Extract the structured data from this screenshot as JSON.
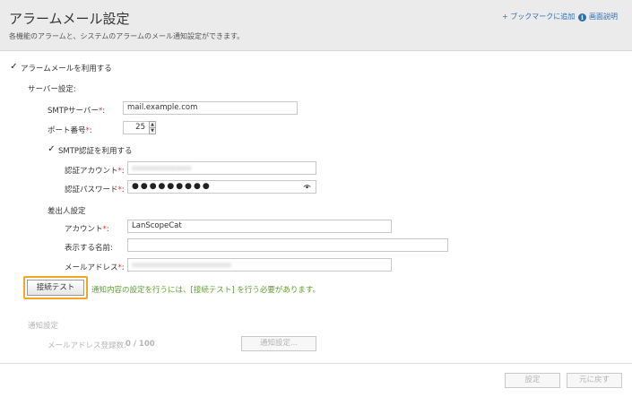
{
  "header": {
    "title": "アラームメール設定",
    "subtitle": "各機能のアラームと、システムのアラームのメール通知設定ができます。",
    "bookmark_link": "+ ブックマークに追加",
    "help_link": "画面説明"
  },
  "use_alarm_mail": {
    "label": "アラームメールを利用する",
    "checked": true
  },
  "server": {
    "section_label": "サーバー設定:",
    "smtp_label": "SMTPサーバー",
    "smtp_value": "mail.example.com",
    "port_label": "ポート番号",
    "port_value": "25",
    "smtp_auth": {
      "label": "SMTP認証を利用する",
      "checked": true
    },
    "account_label": "認証アカウント",
    "account_value": "xxxxxxxxxxxxxxx",
    "password_label": "認証パスワード",
    "password_value": "●●●●●●●●●"
  },
  "sender": {
    "section_label": "差出人設定",
    "account_label": "アカウント",
    "account_value": "LanScopeCat",
    "display_name_label": "表示する名前:",
    "display_name_value": "",
    "email_label": "メールアドレス",
    "email_value": "xxxxxxxxxxxxxxxxxxxxxxxxx"
  },
  "test": {
    "button_label": "接続テスト",
    "note": "通知内容の設定を行うには、[接続テスト] を行う必要があります。"
  },
  "notification": {
    "section_label": "通知設定",
    "registered_label": "メールアドレス登録数:",
    "registered_value": "0 / 100",
    "settings_button": "通知設定..."
  },
  "footer": {
    "save_button": "設定",
    "reset_button": "元に戻す"
  },
  "required_mark": "*",
  "colon": ":"
}
